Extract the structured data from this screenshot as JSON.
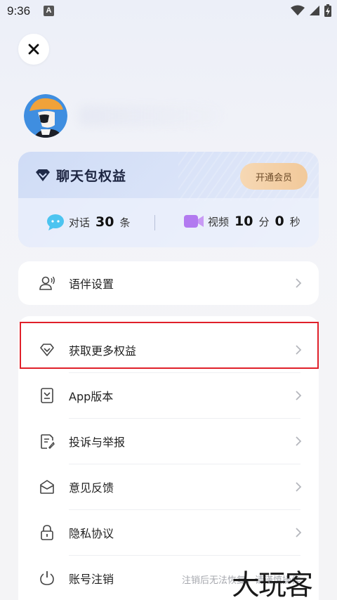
{
  "status_bar": {
    "time": "9:36",
    "notification_letter": "A"
  },
  "benefits": {
    "title": "聊天包权益",
    "vip_button": "开通会员",
    "chat": {
      "label": "对话",
      "count": "30",
      "unit": "条"
    },
    "video": {
      "label": "视频",
      "minutes": "10",
      "min_unit": "分",
      "seconds": "0",
      "sec_unit": "秒"
    }
  },
  "menu_top": [
    {
      "label": "语伴设置",
      "icon": "companion-voice-icon"
    }
  ],
  "menu_main": [
    {
      "label": "获取更多权益",
      "icon": "diamond-icon"
    },
    {
      "label": "App版本",
      "icon": "download-box-icon"
    },
    {
      "label": "投诉与举报",
      "icon": "report-doc-icon"
    },
    {
      "label": "意见反馈",
      "icon": "feedback-envelope-icon"
    },
    {
      "label": "隐私协议",
      "icon": "lock-icon"
    },
    {
      "label": "账号注销",
      "icon": "power-icon",
      "note": "注销后无法恢复，请谨慎操作"
    }
  ],
  "watermark": "大玩客"
}
